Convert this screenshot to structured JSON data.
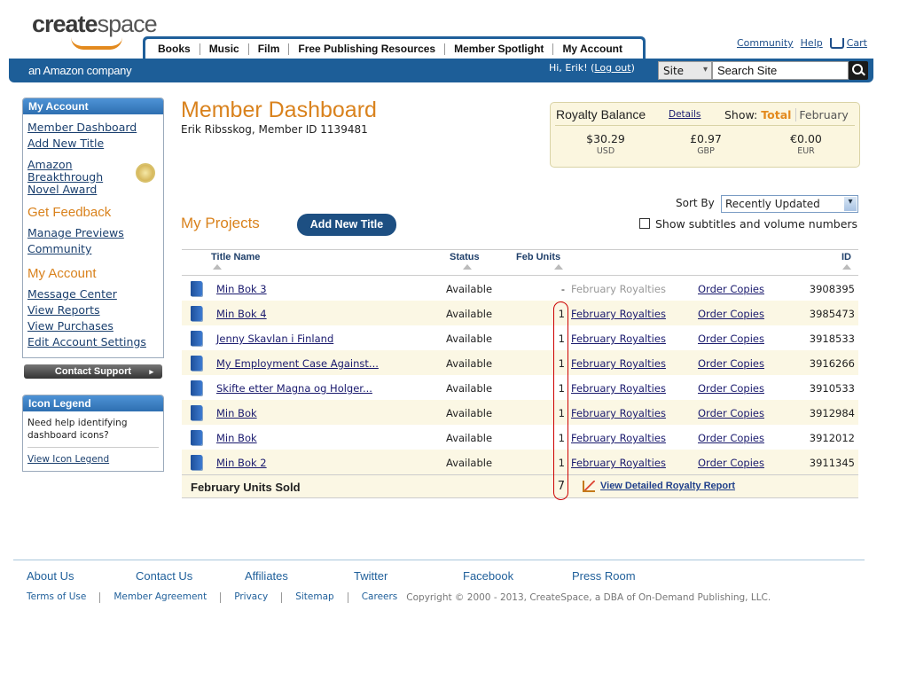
{
  "brand": {
    "logo_bold": "create",
    "logo_light": "space",
    "tagline": "an Amazon company"
  },
  "nav_tabs": [
    "Books",
    "Music",
    "Film",
    "Free Publishing Resources",
    "Member Spotlight",
    "My Account"
  ],
  "top_links": {
    "community": "Community",
    "help": "Help",
    "cart": "Cart"
  },
  "greeting": {
    "text": "Hi, Erik! (",
    "logout": "Log out",
    "close": ")"
  },
  "search": {
    "scope": "Site",
    "placeholder": "Search Site"
  },
  "sidebar": {
    "account_header": "My Account",
    "links": [
      "Member Dashboard",
      "Add New Title"
    ],
    "award": "Amazon Breakthrough Novel Award",
    "feedback_title": "Get Feedback",
    "feedback_links": [
      "Manage Previews",
      "Community"
    ],
    "account_title": "My Account",
    "account_links": [
      "Message Center",
      "View Reports",
      "View Purchases",
      "Edit Account Settings"
    ],
    "contact_support": "Contact Support",
    "legend_header": "Icon Legend",
    "legend_text": "Need help identifying dashboard icons?",
    "legend_link": "View Icon Legend"
  },
  "page": {
    "title": "Member Dashboard",
    "member_line": "Erik Ribsskog, Member ID 1139481"
  },
  "royalty": {
    "title": "Royalty Balance",
    "details": "Details",
    "show_label": "Show:",
    "show_total": "Total",
    "show_month": "February",
    "amounts": [
      {
        "value": "$30.29",
        "currency": "USD"
      },
      {
        "value": "£0.97",
        "currency": "GBP"
      },
      {
        "value": "€0.00",
        "currency": "EUR"
      }
    ]
  },
  "projects": {
    "title": "My Projects",
    "add_button": "Add New Title",
    "sort_label": "Sort By",
    "sort_value": "Recently Updated",
    "show_subtitles": "Show subtitles and volume numbers",
    "columns": {
      "title": "Title Name",
      "status": "Status",
      "units": "Feb Units",
      "id": "ID"
    },
    "rows": [
      {
        "title": "Min Bok 3",
        "status": "Available",
        "units": "-",
        "royalties": "February Royalties",
        "order": "Order Copies",
        "id": "3908395",
        "royalty_link": false
      },
      {
        "title": "Min Bok 4",
        "status": "Available",
        "units": "1",
        "royalties": "February Royalties",
        "order": "Order Copies",
        "id": "3985473",
        "royalty_link": true
      },
      {
        "title": "Jenny Skavlan i Finland",
        "status": "Available",
        "units": "1",
        "royalties": "February Royalties",
        "order": "Order Copies",
        "id": "3918533",
        "royalty_link": true
      },
      {
        "title": "My Employment Case Against...",
        "status": "Available",
        "units": "1",
        "royalties": "February Royalties",
        "order": "Order Copies",
        "id": "3916266",
        "royalty_link": true
      },
      {
        "title": "Skifte etter Magna og Holger...",
        "status": "Available",
        "units": "1",
        "royalties": "February Royalties",
        "order": "Order Copies",
        "id": "3910533",
        "royalty_link": true
      },
      {
        "title": "Min Bok",
        "status": "Available",
        "units": "1",
        "royalties": "February Royalties",
        "order": "Order Copies",
        "id": "3912984",
        "royalty_link": true
      },
      {
        "title": "Min Bok",
        "status": "Available",
        "units": "1",
        "royalties": "February Royalties",
        "order": "Order Copies",
        "id": "3912012",
        "royalty_link": true
      },
      {
        "title": "Min Bok 2",
        "status": "Available",
        "units": "1",
        "royalties": "February Royalties",
        "order": "Order Copies",
        "id": "3911345",
        "royalty_link": true
      }
    ],
    "footer_label": "February Units Sold",
    "footer_total": "7",
    "report_link": "View Detailed Royalty Report"
  },
  "footer": {
    "links": [
      "About Us",
      "Contact Us",
      "Affiliates",
      "Twitter",
      "Facebook",
      "Press Room"
    ],
    "small_links": [
      "Terms of Use",
      "Member Agreement",
      "Privacy",
      "Sitemap",
      "Careers"
    ],
    "copyright": "Copyright © 2000 - 2013, CreateSpace, a DBA of On-Demand Publishing, LLC."
  },
  "colors": {
    "brand_blue": "#1d5e98",
    "accent_orange": "#d9821d",
    "row_alt": "#fbf7e4"
  }
}
